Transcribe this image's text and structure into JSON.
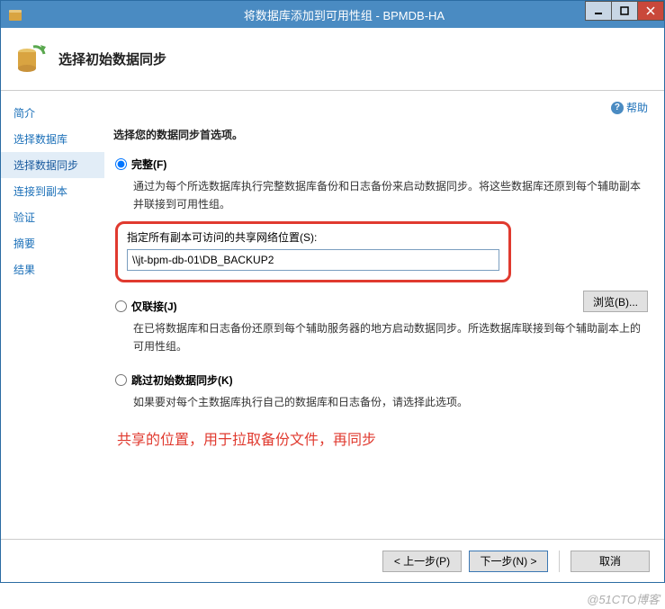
{
  "titlebar": {
    "title": "将数据库添加到可用性组 - BPMDB-HA"
  },
  "header": {
    "title": "选择初始数据同步"
  },
  "help": {
    "label": "帮助"
  },
  "sidebar": {
    "items": [
      {
        "label": "简介"
      },
      {
        "label": "选择数据库"
      },
      {
        "label": "选择数据同步"
      },
      {
        "label": "连接到副本"
      },
      {
        "label": "验证"
      },
      {
        "label": "摘要"
      },
      {
        "label": "结果"
      }
    ],
    "active_index": 2
  },
  "content": {
    "heading": "选择您的数据同步首选项。",
    "option_full": {
      "label": "完整(F)",
      "desc": "通过为每个所选数据库执行完整数据库备份和日志备份来启动数据同步。将这些数据库还原到每个辅助副本并联接到可用性组。",
      "network_label": "指定所有副本可访问的共享网络位置(S):",
      "path_value": "\\\\jt-bpm-db-01\\DB_BACKUP2",
      "browse_label": "浏览(B)..."
    },
    "option_join": {
      "label": "仅联接(J)",
      "desc": "在已将数据库和日志备份还原到每个辅助服务器的地方启动数据同步。所选数据库联接到每个辅助副本上的可用性组。"
    },
    "option_skip": {
      "label": "跳过初始数据同步(K)",
      "desc": "如果要对每个主数据库执行自己的数据库和日志备份，请选择此选项。"
    },
    "annotation": "共享的位置，用于拉取备份文件，再同步"
  },
  "footer": {
    "prev": "< 上一步(P)",
    "next": "下一步(N) >",
    "cancel": "取消"
  },
  "watermark": "@51CTO博客"
}
